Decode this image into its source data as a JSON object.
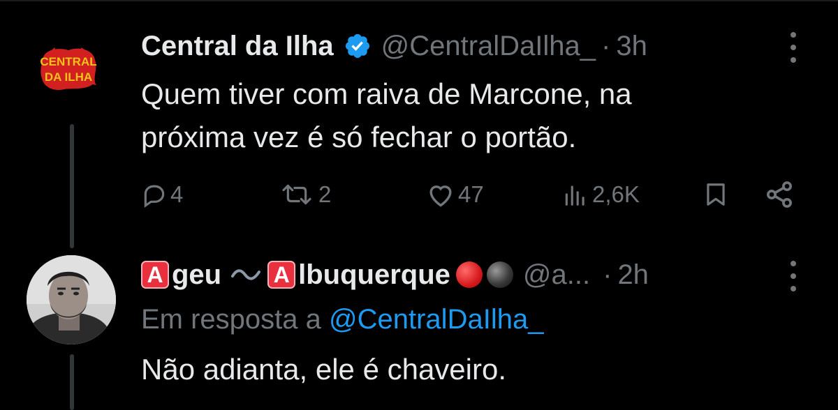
{
  "tweet": {
    "author_name": "Central da Ilha",
    "handle": "@CentralDaIlha_",
    "separator": "·",
    "time": "3h",
    "logo_text_line1": "CENTRAL",
    "logo_text_line2": "DA ILHA",
    "text_lines": [
      "Quem tiver com raiva de Marcone, na",
      "próxima vez é só fechar o portão."
    ],
    "stats": {
      "replies": "4",
      "retweets": "2",
      "likes": "47",
      "views": "2,6K"
    }
  },
  "reply": {
    "name_part1": "geu",
    "name_part2": "lbuquerque",
    "emoji_letter": "A",
    "handle": "@a...",
    "separator": "·",
    "time": "2h",
    "reply_to_prefix": "Em resposta a",
    "reply_to_mention": "@CentralDaIlha_",
    "text": "Não adianta, ele é chaveiro."
  },
  "colors": {
    "background": "#000000",
    "text_primary": "#e7e9ea",
    "text_secondary": "#71767b",
    "link": "#1d9bf0",
    "verified": "#1d9bf0",
    "thread_line": "#333639"
  }
}
